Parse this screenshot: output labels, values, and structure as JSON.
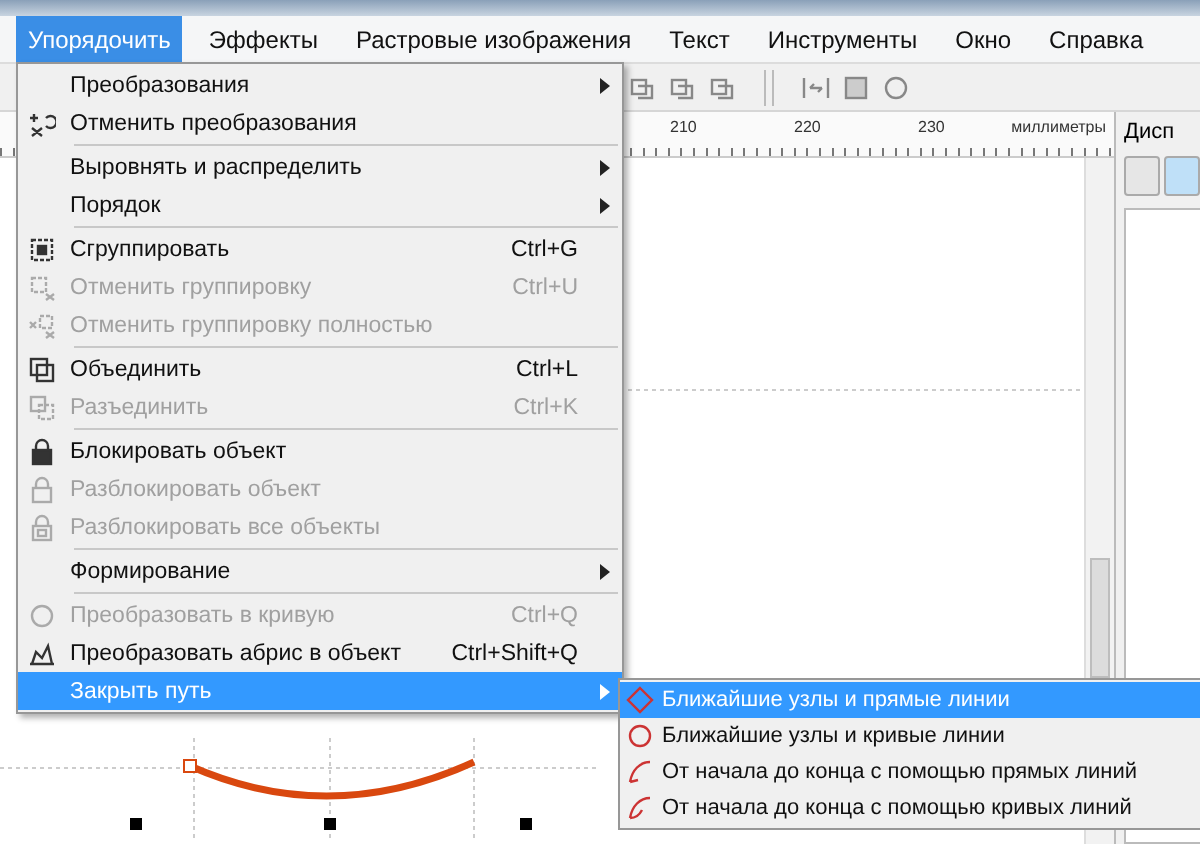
{
  "menubar": [
    {
      "label": "Упорядочить",
      "selected": true
    },
    {
      "label": "Эффекты",
      "selected": false
    },
    {
      "label": "Растровые изображения",
      "selected": false
    },
    {
      "label": "Текст",
      "selected": false
    },
    {
      "label": "Инструменты",
      "selected": false
    },
    {
      "label": "Окно",
      "selected": false
    },
    {
      "label": "Справка",
      "selected": false
    }
  ],
  "ruler": {
    "labels": [
      "210",
      "220",
      "230"
    ],
    "unit": "миллиметры"
  },
  "docker": {
    "title": "Дисп"
  },
  "menu": [
    {
      "kind": "item",
      "label": "Преобразования",
      "submenu": true,
      "disabled": false,
      "selected": false
    },
    {
      "kind": "item",
      "label": "Отменить преобразования",
      "disabled": false,
      "selected": false
    },
    {
      "kind": "separator"
    },
    {
      "kind": "item",
      "label": "Выровнять и распределить",
      "submenu": true,
      "disabled": false,
      "selected": false
    },
    {
      "kind": "item",
      "label": "Порядок",
      "submenu": true,
      "disabled": false,
      "selected": false
    },
    {
      "kind": "separator"
    },
    {
      "kind": "item",
      "label": "Сгруппировать",
      "shortcut": "Ctrl+G",
      "disabled": false,
      "selected": false
    },
    {
      "kind": "item",
      "label": "Отменить группировку",
      "shortcut": "Ctrl+U",
      "disabled": true,
      "selected": false
    },
    {
      "kind": "item",
      "label": "Отменить группировку полностью",
      "disabled": true,
      "selected": false
    },
    {
      "kind": "separator"
    },
    {
      "kind": "item",
      "label": "Объединить",
      "shortcut": "Ctrl+L",
      "disabled": false,
      "selected": false
    },
    {
      "kind": "item",
      "label": "Разъединить",
      "shortcut": "Ctrl+K",
      "disabled": true,
      "selected": false
    },
    {
      "kind": "separator"
    },
    {
      "kind": "item",
      "label": "Блокировать объект",
      "disabled": false,
      "selected": false
    },
    {
      "kind": "item",
      "label": "Разблокировать объект",
      "disabled": true,
      "selected": false
    },
    {
      "kind": "item",
      "label": "Разблокировать все объекты",
      "disabled": true,
      "selected": false
    },
    {
      "kind": "separator"
    },
    {
      "kind": "item",
      "label": "Формирование",
      "submenu": true,
      "disabled": false,
      "selected": false
    },
    {
      "kind": "separator"
    },
    {
      "kind": "item",
      "label": "Преобразовать в кривую",
      "shortcut": "Ctrl+Q",
      "disabled": true,
      "selected": false
    },
    {
      "kind": "item",
      "label": "Преобразовать абрис в объект",
      "shortcut": "Ctrl+Shift+Q",
      "disabled": false,
      "selected": false
    },
    {
      "kind": "item",
      "label": "Закрыть путь",
      "submenu": true,
      "disabled": false,
      "selected": true
    }
  ],
  "submenu": [
    {
      "label": "Ближайшие узлы и прямые линии",
      "selected": true
    },
    {
      "label": "Ближайшие узлы и кривые линии",
      "selected": false
    },
    {
      "label": "От начала до конца с помощью прямых линий",
      "selected": false
    },
    {
      "label": "От начала до конца с помощью кривых линий",
      "selected": false
    }
  ]
}
